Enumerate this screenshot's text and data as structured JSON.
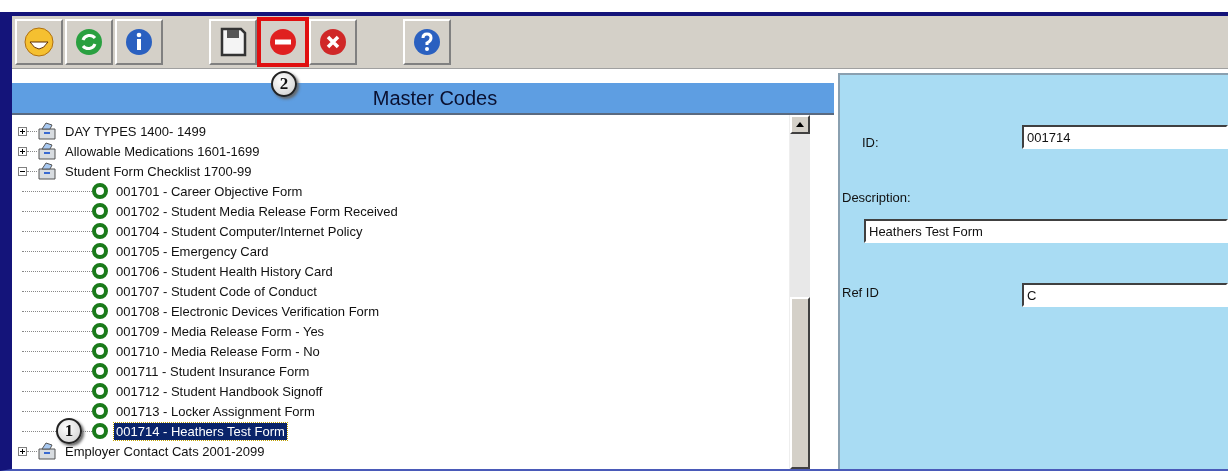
{
  "toolbar": {
    "buttons": [
      {
        "kind": "smiley",
        "highlighted": false
      },
      {
        "kind": "refresh",
        "highlighted": false
      },
      {
        "kind": "info",
        "highlighted": false
      },
      {
        "kind": "gap"
      },
      {
        "kind": "save",
        "highlighted": false
      },
      {
        "kind": "remove",
        "highlighted": true,
        "callout": "2"
      },
      {
        "kind": "cancel",
        "highlighted": false
      },
      {
        "kind": "gap"
      },
      {
        "kind": "help",
        "highlighted": false
      }
    ]
  },
  "master_codes": {
    "title": "Master Codes",
    "tree": [
      {
        "label": "DAY TYPES 1400- 1499",
        "expanded": false,
        "selected": false
      },
      {
        "label": "Allowable Medications 1601-1699",
        "expanded": false,
        "selected": false
      },
      {
        "label": "Student Form Checklist 1700-99",
        "expanded": true,
        "selected": false,
        "children": [
          {
            "label": "001701 - Career Objective Form",
            "selected": false
          },
          {
            "label": "001702 - Student Media Release Form Received",
            "selected": false
          },
          {
            "label": "001704 - Student Computer/Internet Policy",
            "selected": false
          },
          {
            "label": "001705 - Emergency Card",
            "selected": false
          },
          {
            "label": "001706 - Student Health History Card",
            "selected": false
          },
          {
            "label": "001707 - Student Code of Conduct",
            "selected": false
          },
          {
            "label": "001708 - Electronic Devices Verification Form",
            "selected": false
          },
          {
            "label": "001709 - Media Release Form - Yes",
            "selected": false
          },
          {
            "label": "001710 - Media Release Form - No",
            "selected": false
          },
          {
            "label": "001711 - Student Insurance Form",
            "selected": false
          },
          {
            "label": "001712 - Student Handbook Signoff",
            "selected": false
          },
          {
            "label": "001713 - Locker Assignment Form",
            "selected": false
          },
          {
            "label": "001714 - Heathers Test Form",
            "selected": true,
            "callout": "1"
          }
        ]
      },
      {
        "label": "Employer Contact Cats 2001-2099",
        "expanded": false,
        "selected": false
      }
    ]
  },
  "detail": {
    "id": {
      "label": "ID:",
      "value": "001714"
    },
    "description": {
      "label": "Description:",
      "value": "Heathers Test Form"
    },
    "ref_id": {
      "label": "Ref ID",
      "value": "C"
    }
  }
}
